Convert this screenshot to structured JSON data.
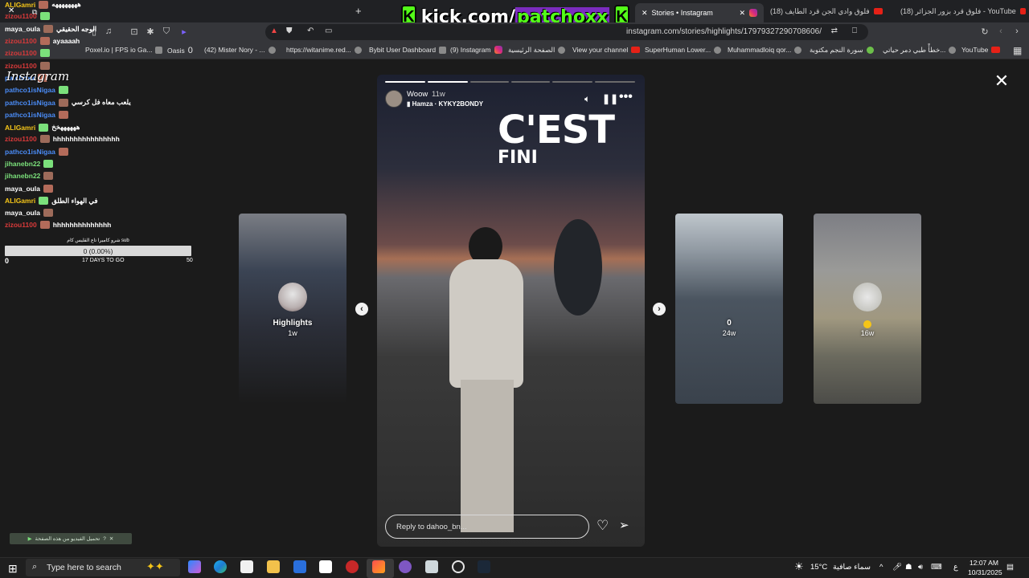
{
  "tabs": [
    {
      "label": "Stories • Instagram",
      "active": true
    },
    {
      "label": "(18) فلوق وادي الجن قرد الطايف"
    },
    {
      "label": "(18) فلوق قرد بزور الجزائر - YouTube"
    }
  ],
  "overlay": {
    "kick_prefix": "kick.com/",
    "kick_channel": "patchoxx",
    "kick_logo_letter": "K"
  },
  "address_bar": {
    "url": "instagram.com/stories/highlights/17979327290708606/"
  },
  "bookmarks": [
    "Poxel.io | FPS io Ga...",
    "Oasis",
    "(42) Mister Nory - ...",
    "https://witanime.red...",
    "Bybit User Dashboard",
    "(9) Instagram",
    "الصفحة الرئيسية",
    "View your channel",
    "SuperHuman Lower...",
    "Muhammadloiq qor...",
    "سورة النجم مكتوبة",
    "خطأً طبي دمر حياتي...",
    "YouTube"
  ],
  "bookmark_oasis_count": "0",
  "chat": {
    "brand": "Instagram",
    "messages": [
      {
        "user": "ALIGamri",
        "text": "ههههههههه",
        "user_color": "#f5c518"
      },
      {
        "user": "zizou1100",
        "text": "",
        "user_color": "#d93a3a"
      },
      {
        "user": "maya_oula",
        "text": "الوجه الحقيقي",
        "user_color": "#ffffff"
      },
      {
        "user": "zizou1100",
        "text": "ayaaaah",
        "user_color": "#d93a3a"
      },
      {
        "user": "zizou1100",
        "text": "",
        "user_color": "#d93a3a"
      },
      {
        "user": "zizou1100",
        "text": "",
        "user_color": "#d93a3a"
      },
      {
        "user": "patchoxx",
        "text": "",
        "user_color": "#4a8bf5"
      },
      {
        "user": "pathco1isNigaa",
        "text": "",
        "user_color": "#4a8bf5"
      },
      {
        "user": "pathco1isNigaa",
        "text": "يلعب معاه فل كرسي",
        "user_color": "#4a8bf5"
      },
      {
        "user": "pathco1isNigaa",
        "text": "",
        "user_color": "#4a8bf5"
      },
      {
        "user": "ALIGamri",
        "text": "ههههههخخ",
        "user_color": "#f5c518"
      },
      {
        "user": "zizou1100",
        "text": "hhhhhhhhhhhhhhhh",
        "user_color": "#d93a3a"
      },
      {
        "user": "pathco1isNigaa",
        "text": "",
        "user_color": "#4a8bf5"
      },
      {
        "user": "jihanebn22",
        "text": "",
        "user_color": "#7be07b"
      },
      {
        "user": "jihanebn22",
        "text": "",
        "user_color": "#7be07b"
      },
      {
        "user": "maya_oula",
        "text": "",
        "user_color": "#ffffff"
      },
      {
        "user": "ALIGamri",
        "text": "في الهواء الطلق",
        "user_color": "#f5c518"
      },
      {
        "user": "maya_oula",
        "text": "",
        "user_color": "#ffffff"
      },
      {
        "user": "zizou1100",
        "text": "hhhhhhhhhhhhhh",
        "user_color": "#d93a3a"
      }
    ]
  },
  "goal": {
    "title": "شرو كاميرا تاع القليس كام sub",
    "value": "0 (0.00%)",
    "progress": 0,
    "start": "0",
    "remaining": "17 DAYS TO GO",
    "target": "50"
  },
  "story": {
    "username": "Woow",
    "age": "11w",
    "music": "Hamza · KYKY2BONDY",
    "text_line1": "C'EST",
    "text_line2": "FINI",
    "reply_placeholder": "Reply to dahoo_bn..."
  },
  "side_stories": {
    "left": {
      "name": "Highlights",
      "age": "1w"
    },
    "right1": {
      "name": "0",
      "age": "24w"
    },
    "right2": {
      "name": "",
      "age": "16w"
    }
  },
  "mini_overlay": {
    "text": "تحميل الفيديو من هذه الصفحة"
  },
  "taskbar": {
    "search_placeholder": "Type here to search",
    "weather_temp": "15°C",
    "weather_text": "سماء صافية",
    "lang": "ع",
    "time": "12:07 AM",
    "date": "10/31/2025"
  }
}
